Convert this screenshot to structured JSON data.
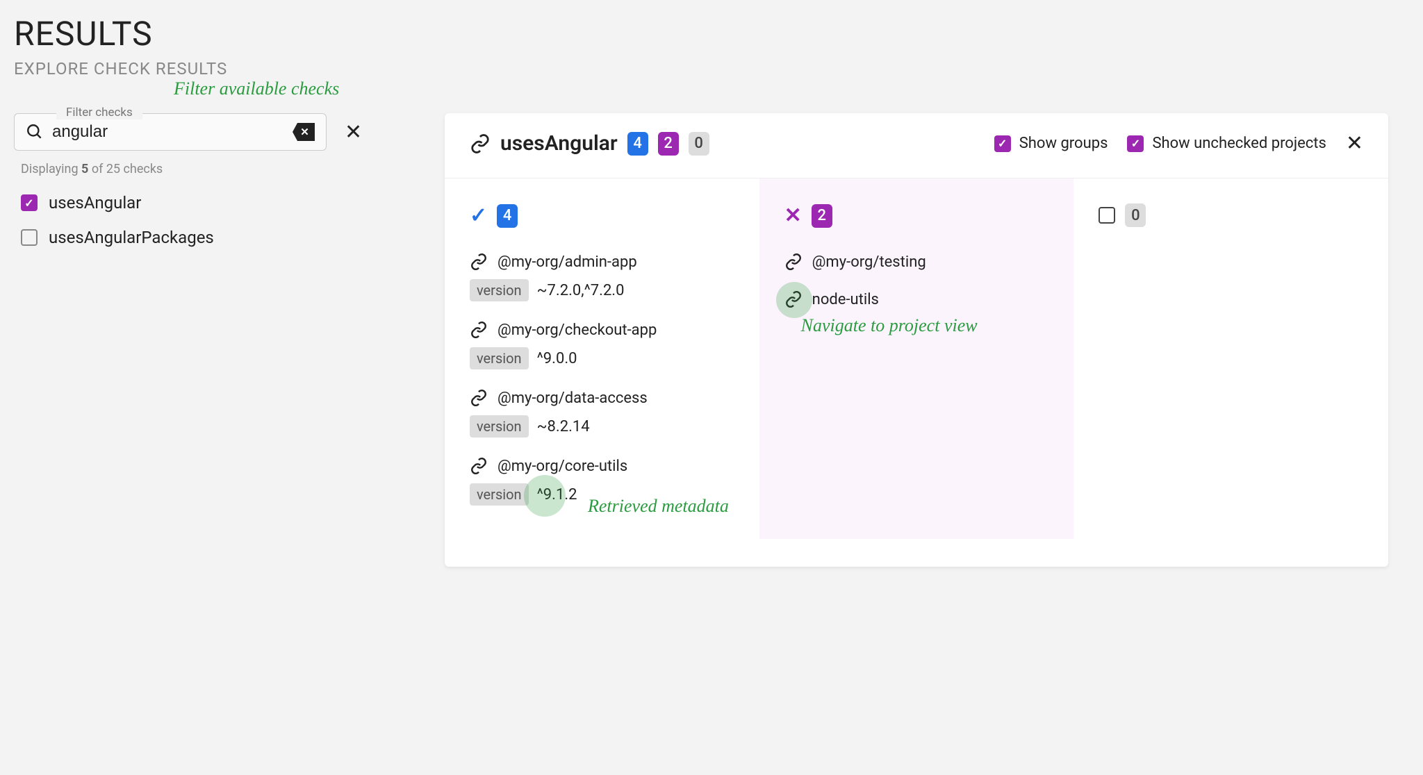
{
  "header": {
    "title": "RESULTS",
    "subtitle": "EXPLORE CHECK RESULTS"
  },
  "annotations": {
    "filter": "Filter available checks",
    "navigate": "Navigate to project view",
    "metadata": "Retrieved metadata"
  },
  "filter": {
    "legend": "Filter checks",
    "value": "angular",
    "placeholder": "Filter checks"
  },
  "counts": {
    "prefix": "Displaying ",
    "shown": "5",
    "middle": " of 25 checks"
  },
  "checks": [
    {
      "label": "usesAngular",
      "checked": true
    },
    {
      "label": "usesAngularPackages",
      "checked": false
    }
  ],
  "panel": {
    "title": "usesAngular",
    "badges": {
      "pass": "4",
      "fail": "2",
      "none": "0"
    },
    "controls": {
      "show_groups": {
        "label": "Show groups",
        "checked": true
      },
      "show_unchecked": {
        "label": "Show unchecked projects",
        "checked": true
      }
    }
  },
  "columns": {
    "pass": {
      "count": "4",
      "projects": [
        {
          "name": "@my-org/admin-app",
          "meta_label": "version",
          "meta_value": "~7.2.0,^7.2.0"
        },
        {
          "name": "@my-org/checkout-app",
          "meta_label": "version",
          "meta_value": "^9.0.0"
        },
        {
          "name": "@my-org/data-access",
          "meta_label": "version",
          "meta_value": "~8.2.14"
        },
        {
          "name": "@my-org/core-utils",
          "meta_label": "version",
          "meta_value": "^9.1.2"
        }
      ]
    },
    "fail": {
      "count": "2",
      "projects": [
        {
          "name": "@my-org/testing"
        },
        {
          "name": "node-utils"
        }
      ]
    },
    "none": {
      "count": "0",
      "projects": []
    }
  }
}
